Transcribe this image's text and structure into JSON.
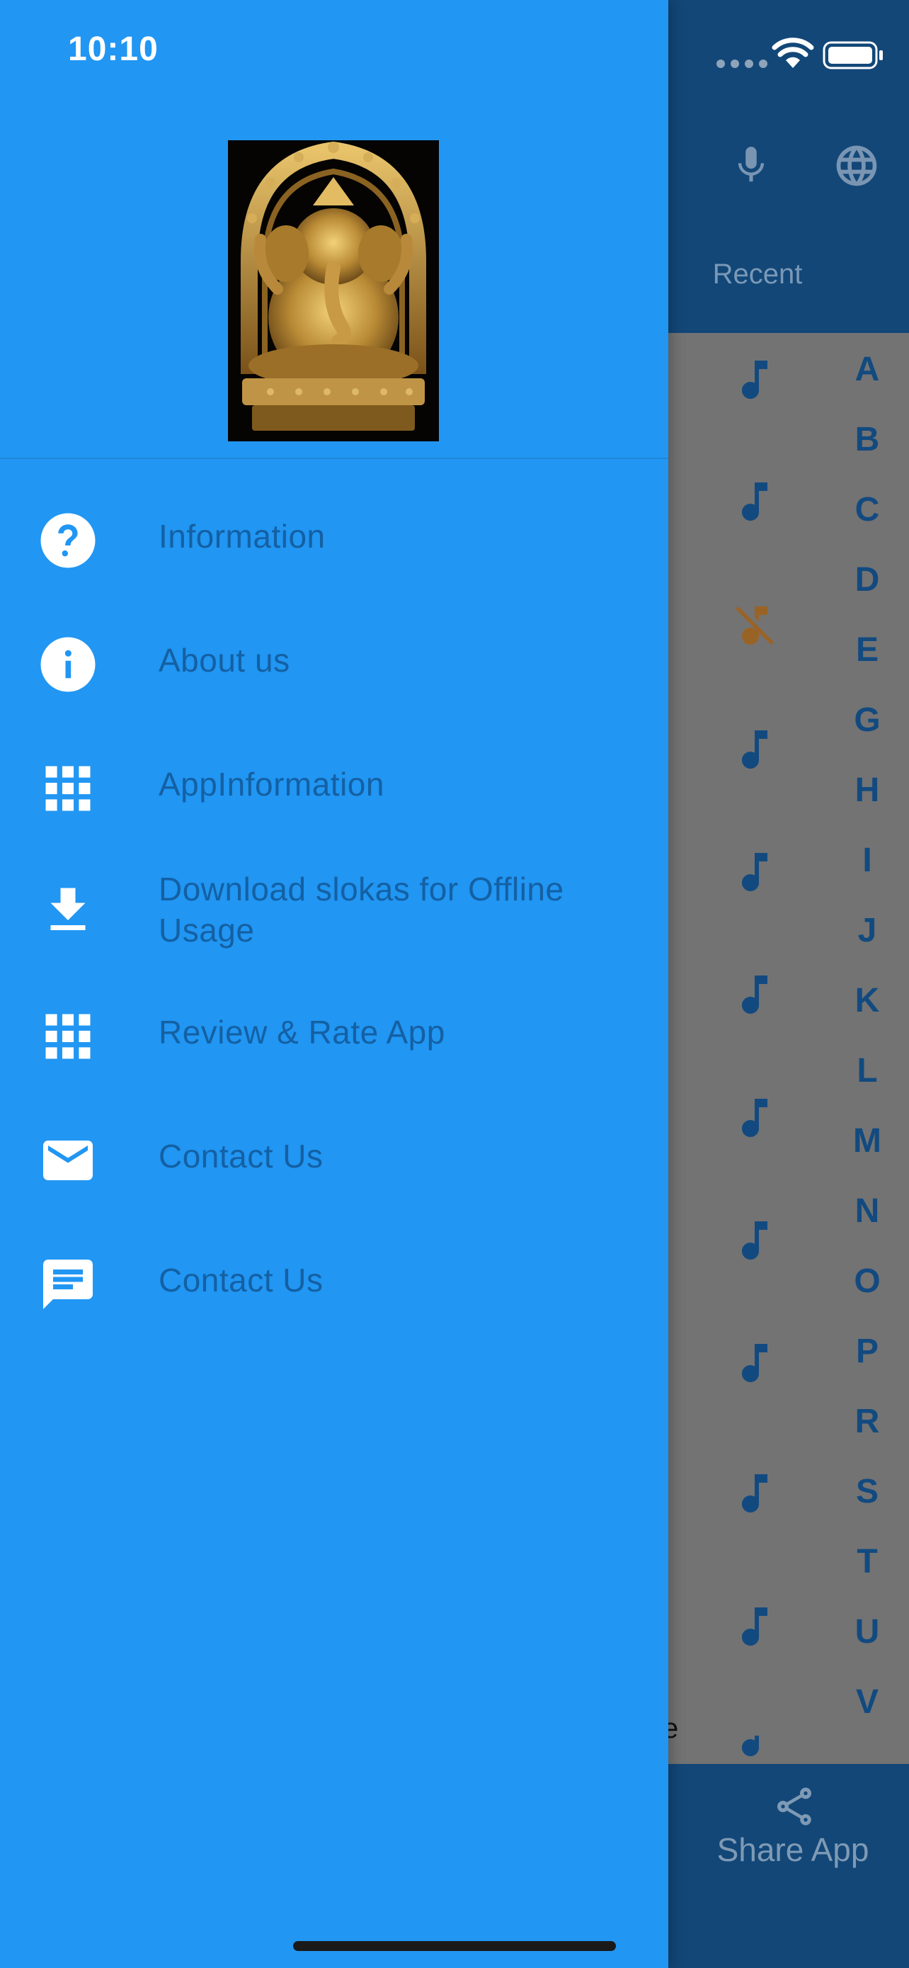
{
  "status_bar": {
    "time": "10:10"
  },
  "background_app": {
    "header": {
      "icons": [
        "mic-icon",
        "globe-icon"
      ],
      "tab_label": "Recent"
    },
    "alphabet_index": [
      "A",
      "B",
      "C",
      "D",
      "E",
      "G",
      "H",
      "I",
      "J",
      "K",
      "L",
      "M",
      "N",
      "O",
      "P",
      "R",
      "S",
      "T",
      "U",
      "V"
    ],
    "stray_text": "e",
    "bottom_bar": {
      "share_label": "Share App"
    }
  },
  "drawer": {
    "header_image": "ganesha-idol-image",
    "menu": [
      {
        "icon": "help-circle-icon",
        "label": "Information"
      },
      {
        "icon": "info-circle-icon",
        "label": "About us"
      },
      {
        "icon": "apps-grid-icon",
        "label": "AppInformation"
      },
      {
        "icon": "download-icon",
        "label": "Download slokas for Offline Usage"
      },
      {
        "icon": "apps-grid-icon",
        "label": "Review & Rate App"
      },
      {
        "icon": "mail-icon",
        "label": "Contact Us"
      },
      {
        "icon": "chat-icon",
        "label": "Contact Us"
      }
    ]
  },
  "colors": {
    "drawer": "#2196f3",
    "label": "#1460a3",
    "header_bg": "#124778",
    "overlay": "#737373",
    "music_off": "#9a6326"
  }
}
